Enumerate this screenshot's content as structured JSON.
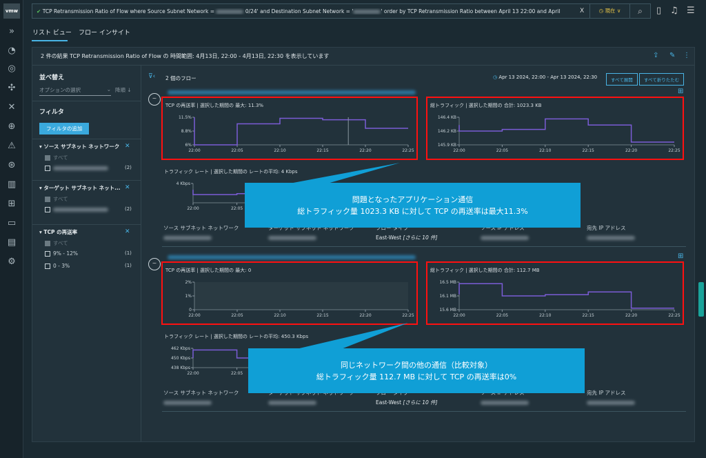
{
  "app": {
    "logo": "vmw"
  },
  "search": {
    "query_start": "TCP Retransmission Ratio of Flow where  Source Subnet Network = ",
    "query_mid": "0/24' and  Destination Subnet Network = '",
    "query_end": "' order by  TCP Retransmission Ratio between April 13 22:00 and April",
    "clear": "X",
    "time_label": "現在",
    "check": "✔"
  },
  "tabs": [
    {
      "label": "リスト ビュー",
      "active": true
    },
    {
      "label": "フロー インサイト",
      "active": false
    }
  ],
  "panel": {
    "header": "2 件の結果 TCP Retransmission Ratio of Flow の 時間範囲: 4月13日, 22:00 - 4月13日, 22:30 を表示しています"
  },
  "sidebar": {
    "sort_title": "並べ替え",
    "sort_placeholder": "オプションの選択",
    "sort_order": "降順 ↓",
    "filter_title": "フィルタ",
    "add_filter": "フィルタの追加",
    "filters": [
      {
        "title": "ソース サブネット ネットワーク",
        "all": "すべて",
        "items": [
          {
            "label": "",
            "count": "(2)"
          }
        ]
      },
      {
        "title": "ターゲット サブネット ネット...",
        "all": "すべて",
        "items": [
          {
            "label": "",
            "count": "(2)"
          }
        ]
      },
      {
        "title": "TCP の再送率",
        "all": "すべて",
        "items": [
          {
            "label": "9% - 12%",
            "count": "(1)"
          },
          {
            "label": "0 - 3%",
            "count": "(1)"
          }
        ]
      }
    ]
  },
  "content": {
    "flow_count": "2 個のフロー",
    "time_range": "Apr 13 2024, 22:00 - Apr 13 2024, 22:30",
    "expand_all": "すべて展開",
    "collapse_all": "すべて折りたたむ"
  },
  "properties": {
    "labels": [
      "ソース サブネット ネットワーク",
      "ターゲット サブネット ネットワーク",
      "フロー タイプ",
      "ソース IP アドレス",
      "宛先 IP アドレス"
    ],
    "flow_type": "East-West",
    "more": "[さらに 10 件]"
  },
  "flows": [
    {
      "charts": [
        {
          "title": "TCP の再送率 | 選択した期間の 最大: 11.3%",
          "yticks": [
            "6%",
            "8.8%",
            "11.5%"
          ],
          "ylim": [
            6,
            11.5
          ],
          "start": 11.5,
          "values": [
            6,
            10.2,
            11.3,
            11.0,
            9.3
          ],
          "cursor": 22.18
        },
        {
          "title": "総トラフィック | 選択した期間の 合計: 1023.3 KB",
          "yticks": [
            "145.9 KB",
            "146.2 KB",
            "146.4 KB"
          ],
          "ylim": [
            145.9,
            146.4
          ],
          "start": 146.26,
          "values": [
            146.15,
            146.18,
            146.37,
            146.26,
            145.95
          ]
        },
        {
          "title": "トラフィック レート | 選択した期間の レートの平均: 4 Kbps",
          "yticks": [
            "",
            "",
            "4 Kbps"
          ],
          "ylim": [
            0,
            4
          ],
          "start": 2.7,
          "values": [
            1.7,
            1.9,
            4,
            4,
            4
          ]
        }
      ]
    },
    {
      "charts": [
        {
          "title": "TCP の再送率 | 選択した期間の 最大: 0",
          "yticks": [
            "0",
            "1%",
            "2%"
          ],
          "ylim": [
            0,
            2
          ],
          "values": []
        },
        {
          "title": "総トラフィック | 選択した期間の 合計: 112.7 MB",
          "yticks": [
            "15.6 MB",
            "16.1 MB",
            "16.5 MB"
          ],
          "ylim": [
            15.6,
            16.5
          ],
          "start": 16.1,
          "values": [
            16.45,
            16.05,
            16.09,
            16.18,
            15.65
          ],
          "cursor": 22.31
        },
        {
          "title": "トラフィック レート | 選択した期間の レートの平均: 450.3 Kbps",
          "yticks": [
            "438 Kbps",
            "450 Kbps",
            "462 Kbps"
          ],
          "ylim": [
            438,
            462
          ],
          "start": 450,
          "values": [
            460,
            450,
            450,
            450,
            450
          ]
        }
      ]
    }
  ],
  "xticks": [
    "22:00",
    "22:05",
    "22:10",
    "22:15",
    "22:20",
    "22:25"
  ],
  "callouts": [
    {
      "line1": "問題となったアプリケーション通信",
      "line2": "総トラフィック量 1023.3 KB に対して TCP の再送率は最大11.3%"
    },
    {
      "line1": "同じネットワーク間の他の通信（比較対象）",
      "line2": "総トラフィック量 112.7 MB に対して TCP の再送率は0%"
    }
  ],
  "colors": {
    "line": "#7b5cd6",
    "callout": "#109fd6",
    "highlight": "#ff1010",
    "accent": "#49b5e6"
  }
}
